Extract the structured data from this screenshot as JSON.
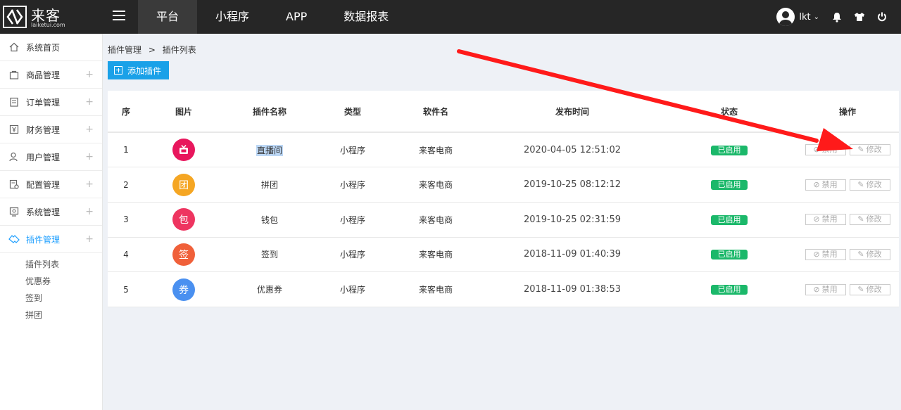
{
  "logo": {
    "cn": "来客",
    "en": "laiketui.com"
  },
  "topnav": {
    "tabs": [
      "平台",
      "小程序",
      "APP",
      "数据报表"
    ]
  },
  "user": {
    "name": "lkt"
  },
  "sidebar": {
    "items": [
      {
        "label": "系统首页",
        "icon": "home-icon"
      },
      {
        "label": "商品管理",
        "icon": "bag-icon"
      },
      {
        "label": "订单管理",
        "icon": "order-icon"
      },
      {
        "label": "财务管理",
        "icon": "finance-icon"
      },
      {
        "label": "用户管理",
        "icon": "user-icon"
      },
      {
        "label": "配置管理",
        "icon": "config-icon"
      },
      {
        "label": "系统管理",
        "icon": "system-icon"
      },
      {
        "label": "插件管理",
        "icon": "plugin-icon"
      }
    ],
    "sub_items": [
      "插件列表",
      "优惠券",
      "签到",
      "拼团"
    ]
  },
  "breadcrumb": {
    "first": "插件管理",
    "sep": ">",
    "second": "插件列表"
  },
  "add_button": "添加插件",
  "table": {
    "headers": [
      "序",
      "图片",
      "插件名称",
      "类型",
      "软件名",
      "发布时间",
      "状态",
      "操作"
    ],
    "rows": [
      {
        "idx": "1",
        "glyph": "",
        "color": "#e8175d",
        "name": "直播间",
        "type": "小程序",
        "app": "来客电商",
        "time": "2020-04-05 12:51:02",
        "status": "已启用"
      },
      {
        "idx": "2",
        "glyph": "团",
        "color": "#f5a623",
        "name": "拼团",
        "type": "小程序",
        "app": "来客电商",
        "time": "2019-10-25 08:12:12",
        "status": "已启用"
      },
      {
        "idx": "3",
        "glyph": "包",
        "color": "#ee3560",
        "name": "钱包",
        "type": "小程序",
        "app": "来客电商",
        "time": "2019-10-25 02:31:59",
        "status": "已启用"
      },
      {
        "idx": "4",
        "glyph": "签",
        "color": "#f0603a",
        "name": "签到",
        "type": "小程序",
        "app": "来客电商",
        "time": "2018-11-09 01:40:39",
        "status": "已启用"
      },
      {
        "idx": "5",
        "glyph": "券",
        "color": "#4a90f0",
        "name": "优惠券",
        "type": "小程序",
        "app": "来客电商",
        "time": "2018-11-09 01:38:53",
        "status": "已启用"
      }
    ],
    "op_disable": "禁用",
    "op_edit": "修改"
  },
  "colors": {
    "accent": "#1aa1e8",
    "status_green": "#1bb86a",
    "arrow_red": "#ff1a1a"
  }
}
